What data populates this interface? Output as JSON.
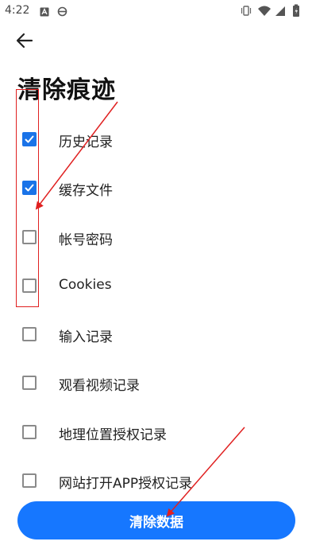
{
  "status_bar": {
    "time": "4:22",
    "left_icons": [
      "a-icon",
      "e-icon"
    ],
    "right_icons": [
      "vibrate-icon",
      "wifi-icon",
      "signal-icon",
      "battery-icon"
    ]
  },
  "header": {
    "back_icon": "arrow-left-icon",
    "title": "清除痕迹"
  },
  "options": [
    {
      "label": "历史记录",
      "checked": true
    },
    {
      "label": "缓存文件",
      "checked": true
    },
    {
      "label": "帐号密码",
      "checked": false
    },
    {
      "label": "Cookies",
      "checked": false
    },
    {
      "label": "输入记录",
      "checked": false
    },
    {
      "label": "观看视频记录",
      "checked": false
    },
    {
      "label": "地理位置授权记录",
      "checked": false
    },
    {
      "label": "网站打开APP授权记录",
      "checked": false
    }
  ],
  "clear_button": {
    "label": "清除数据"
  },
  "colors": {
    "accent": "#1a73e8",
    "button": "#1677ff",
    "annotation": "#e02020"
  }
}
